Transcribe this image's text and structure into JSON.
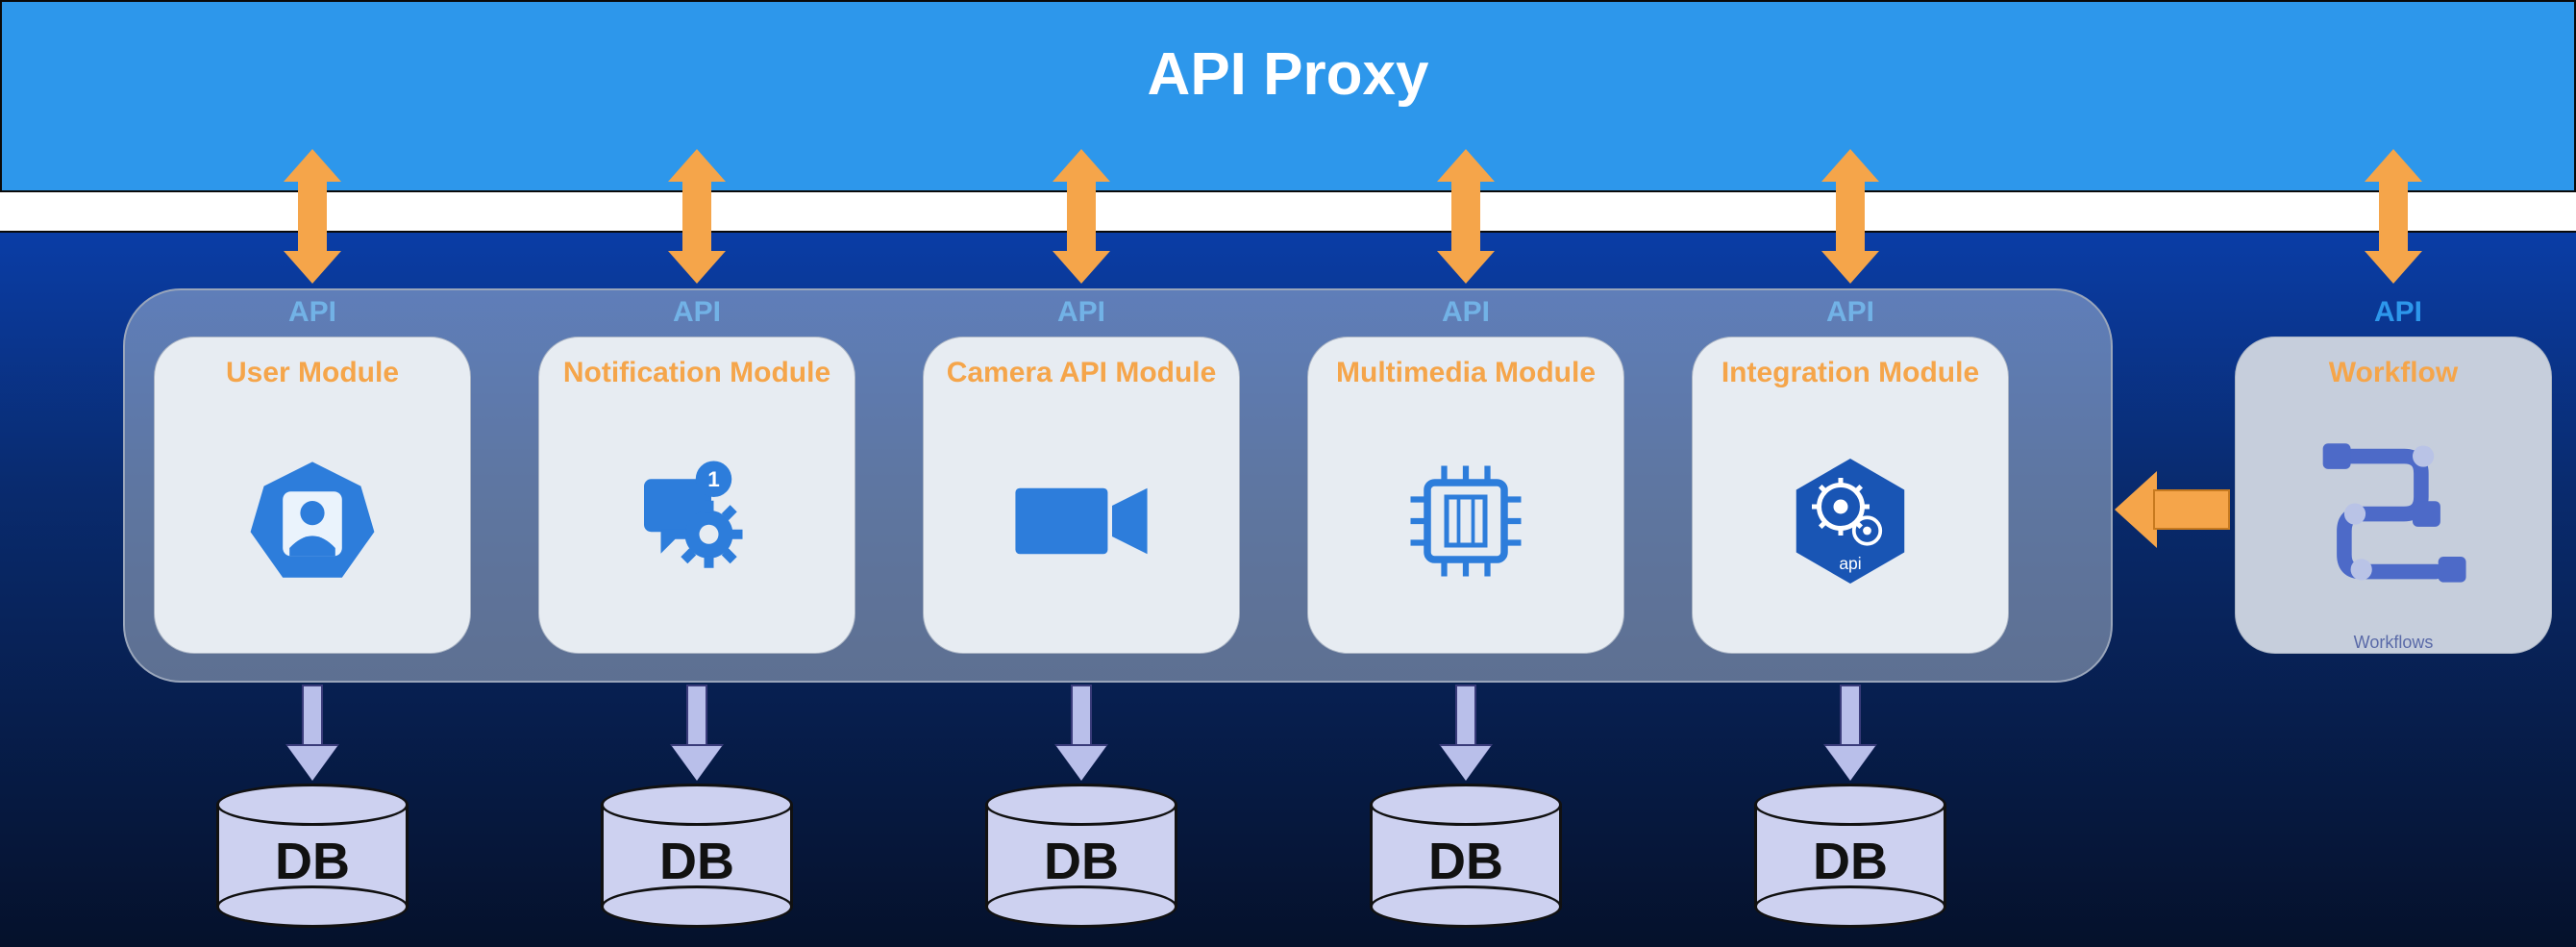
{
  "header": {
    "title": "API Proxy"
  },
  "api_label": "API",
  "modules": [
    {
      "title": "User Module",
      "db_label": "DB",
      "icon": "user-badge"
    },
    {
      "title": "Notification Module",
      "db_label": "DB",
      "icon": "notification-gear",
      "badge": "1"
    },
    {
      "title": "Camera API Module",
      "db_label": "DB",
      "icon": "camera"
    },
    {
      "title": "Multimedia Module",
      "db_label": "DB",
      "icon": "chip"
    },
    {
      "title": "Integration Module",
      "db_label": "DB",
      "icon": "api-hex",
      "icon_text": "api"
    }
  ],
  "workflow": {
    "title": "Workflow",
    "subtitle": "Workflows",
    "icon": "workflow"
  },
  "colors": {
    "topband": "#2D97EB",
    "gradient_top": "#0A3DA6",
    "gradient_bottom": "#05112b",
    "accent_orange": "#F5A54A",
    "card_bg": "#E7ECF2",
    "db_fill": "#CDD1F0",
    "workflow_icon": "#4D6AC8"
  }
}
